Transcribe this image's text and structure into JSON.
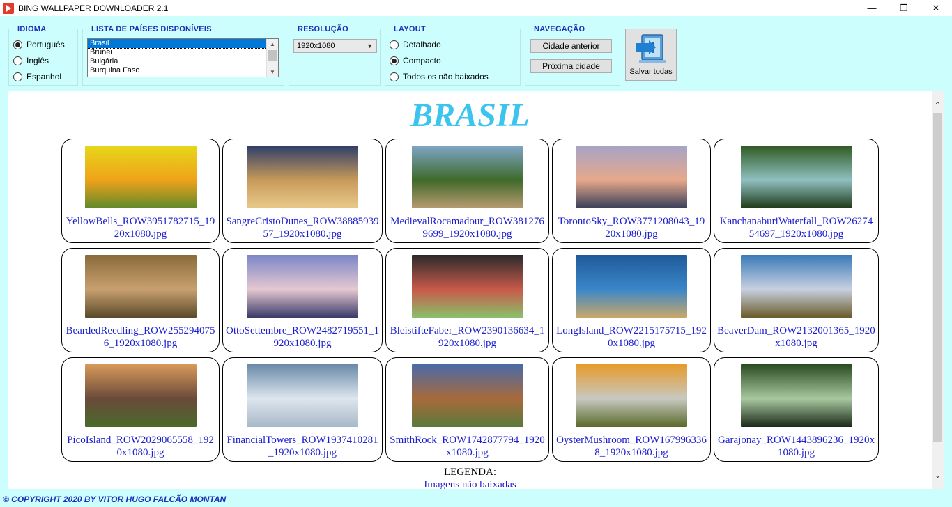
{
  "window": {
    "title": "BING WALLPAPER DOWNLOADER 2.1",
    "minimize": "—",
    "maximize": "❐",
    "close": "✕"
  },
  "idioma": {
    "label": "IDIOMA",
    "options": [
      {
        "label": "Português",
        "checked": true
      },
      {
        "label": "Inglês",
        "checked": false
      },
      {
        "label": "Espanhol",
        "checked": false
      }
    ]
  },
  "paises": {
    "label": "LISTA DE PAÍSES DISPONÍVEIS",
    "items": [
      "Brasil",
      "Brunei",
      "Bulgária",
      "Burquina Faso"
    ],
    "selected": "Brasil"
  },
  "resolucao": {
    "label": "RESOLUÇÃO",
    "value": "1920x1080"
  },
  "layout": {
    "label": "LAYOUT",
    "options": [
      {
        "label": "Detalhado",
        "checked": false
      },
      {
        "label": "Compacto",
        "checked": true
      },
      {
        "label": "Todos os não baixados",
        "checked": false
      }
    ]
  },
  "navegacao": {
    "label": "NAVEGAÇÃO",
    "prev": "Cidade anterior",
    "next": "Próxima cidade"
  },
  "save_all": {
    "label": "Salvar todas",
    "icon": "save-all-icon"
  },
  "content": {
    "heading": "BRASIL",
    "wallpapers": [
      {
        "file": "YellowBells_ROW3951782715_1920x1080.jpg",
        "colors": [
          "#e6d81a",
          "#f0a21a",
          "#5f8a2a"
        ]
      },
      {
        "file": "SangreCristoDunes_ROW3888593957_1920x1080.jpg",
        "colors": [
          "#2d3e6a",
          "#c89a5a",
          "#e8c98a"
        ]
      },
      {
        "file": "MedievalRocamadour_ROW3812769699_1920x1080.jpg",
        "colors": [
          "#7fa6c8",
          "#3f6a2a",
          "#b89a70"
        ]
      },
      {
        "file": "TorontoSky_ROW3771208043_1920x1080.jpg",
        "colors": [
          "#a6a4c8",
          "#e6a88a",
          "#3a3f5a"
        ]
      },
      {
        "file": "KanchanaburiWaterfall_ROW2627454697_1920x1080.jpg",
        "colors": [
          "#2f5a22",
          "#8fc0c0",
          "#1f3a18"
        ]
      },
      {
        "file": "BeardedReedling_ROW2552940756_1920x1080.jpg",
        "colors": [
          "#8a6a3a",
          "#c8a070",
          "#5a4a2a"
        ]
      },
      {
        "file": "OttoSettembre_ROW2482719551_1920x1080.jpg",
        "colors": [
          "#7a86c8",
          "#e6c8d0",
          "#3a3a6a"
        ]
      },
      {
        "file": "BleistifteFaber_ROW2390136634_1920x1080.jpg",
        "colors": [
          "#2a2a2a",
          "#c85a4a",
          "#8ac06a"
        ]
      },
      {
        "file": "LongIsland_ROW2215175715_1920x1080.jpg",
        "colors": [
          "#1f5a9a",
          "#3a86c8",
          "#c8a86a"
        ]
      },
      {
        "file": "BeaverDam_ROW2132001365_1920x1080.jpg",
        "colors": [
          "#3a7ab8",
          "#c8d0e0",
          "#6a5a2a"
        ]
      },
      {
        "file": "PicoIsland_ROW2029065558_1920x1080.jpg",
        "colors": [
          "#d89a5a",
          "#6a4a3a",
          "#4a6a2a"
        ]
      },
      {
        "file": "FinancialTowers_ROW1937410281_1920x1080.jpg",
        "colors": [
          "#6a8aa8",
          "#dde6ee",
          "#a8b8c8"
        ]
      },
      {
        "file": "SmithRock_ROW1742877794_1920x1080.jpg",
        "colors": [
          "#4a6aa8",
          "#a86a3a",
          "#5a7a3a"
        ]
      },
      {
        "file": "OysterMushroom_ROW1679963368_1920x1080.jpg",
        "colors": [
          "#e69a2a",
          "#c8c8c0",
          "#5a6a2a"
        ]
      },
      {
        "file": "Garajonay_ROW1443896236_1920x1080.jpg",
        "colors": [
          "#2a4a22",
          "#a8c8a0",
          "#1a2a18"
        ]
      }
    ],
    "legend_title": "LEGENDA:",
    "legend_item": "Imagens não baixadas"
  },
  "footer": "© COPYRIGHT 2020 BY VITOR HUGO FALCÃO MONTAN"
}
